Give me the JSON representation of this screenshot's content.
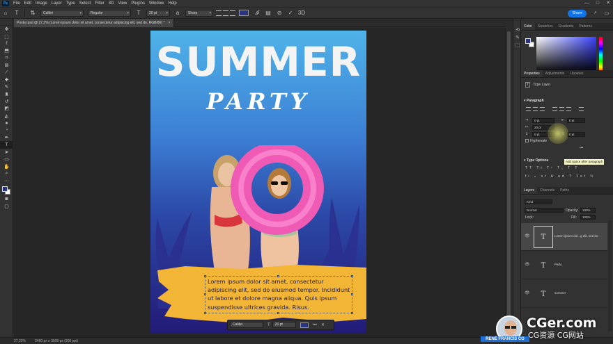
{
  "menubar": {
    "logo": "Ps",
    "items": [
      "File",
      "Edit",
      "Image",
      "Layer",
      "Type",
      "Select",
      "Filter",
      "3D",
      "View",
      "Plugins",
      "Window",
      "Help"
    ],
    "window_controls": [
      "—",
      "□",
      "✕"
    ]
  },
  "options": {
    "font_family": "Calibri",
    "font_style": "Regular",
    "font_size": "20 pt",
    "antialias": "Sharp",
    "text_color": "#283583",
    "share_label": "Share"
  },
  "document": {
    "tab_title": "Poster.psd @ 27,2% (Lorem ipsum dolor sit amet, consectetur adipiscing elit, sed do, RGB/8#) *",
    "close_icon": "×"
  },
  "poster": {
    "title": "SUMMER",
    "subtitle": "PARTY",
    "paragraph": "Lorem ipsum dolor sit amet, consectetur adipiscing elit, sed do eiusmod tempor. Incididunt ut labore et dolore magna aliqua. Quis ipsum suspendisse ultrices gravida. Risus."
  },
  "context_bar": {
    "font": "Calibri",
    "size": "20 pt",
    "more": "•••"
  },
  "status": {
    "zoom": "27,22%",
    "doc_info": "2480 px x 3508 px (300 ppi)"
  },
  "color_panel": {
    "tabs": [
      "Color",
      "Swatches",
      "Gradients",
      "Patterns"
    ],
    "foreground": "#283583",
    "background": "#ffffff"
  },
  "properties_panel": {
    "tabs": [
      "Properties",
      "Adjustments",
      "Libraries"
    ],
    "layer_kind": "Type Layer",
    "paragraph_heading": "Paragraph",
    "indent_left": "0 pt",
    "indent_right": "0 pt",
    "indent_first": "20 pt",
    "space_before": "0 pt",
    "space_after": "0 pt",
    "hyphenate": "Hyphenate",
    "tooltip": "Add space after paragraph",
    "more": "•••",
    "type_options_heading": "Type Options"
  },
  "layers_panel": {
    "tabs": [
      "Layers",
      "Channels",
      "Paths"
    ],
    "filter_placeholder": "Kind",
    "blend_mode": "Normal",
    "opacity_label": "Opacity:",
    "opacity_value": "100%",
    "lock_label": "Lock:",
    "fill_label": "Fill:",
    "fill_value": "100%",
    "layers": [
      {
        "name": "Lorem ipsum dol...g elit, sed do",
        "selected": true
      },
      {
        "name": "Party",
        "selected": false
      },
      {
        "name": "summer",
        "selected": false
      }
    ]
  },
  "watermark": {
    "big": "CGer.com",
    "small": "CG资源 CG网站",
    "author": "RENÉ FRANCIS CO"
  }
}
